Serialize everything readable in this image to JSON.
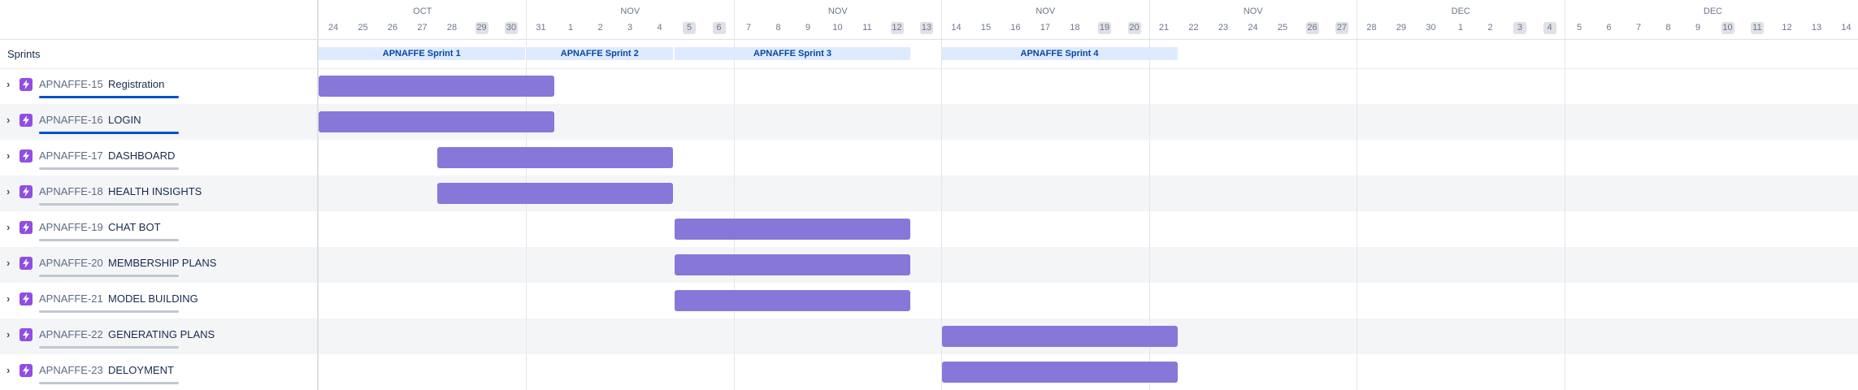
{
  "sprints_label": "Sprints",
  "colors": {
    "bar": "#8777d9",
    "sprint_bg": "#deebff",
    "sprint_text": "#0747a6",
    "progress_done": "#0052cc",
    "progress_todo": "#c1c7d0",
    "issue_icon": "#904ee2"
  },
  "months": [
    {
      "label": "OCT"
    },
    {
      "label": "NOV"
    },
    {
      "label": "NOV"
    },
    {
      "label": "NOV"
    },
    {
      "label": "NOV"
    },
    {
      "label": "DEC"
    },
    {
      "label": "DEC"
    }
  ],
  "days": [
    {
      "label": "24",
      "weekend": false
    },
    {
      "label": "25",
      "weekend": false
    },
    {
      "label": "26",
      "weekend": false
    },
    {
      "label": "27",
      "weekend": false
    },
    {
      "label": "28",
      "weekend": false
    },
    {
      "label": "29",
      "weekend": true
    },
    {
      "label": "30",
      "weekend": true
    },
    {
      "label": "31",
      "weekend": false
    },
    {
      "label": "1",
      "weekend": false
    },
    {
      "label": "2",
      "weekend": false
    },
    {
      "label": "3",
      "weekend": false
    },
    {
      "label": "4",
      "weekend": false
    },
    {
      "label": "5",
      "weekend": true
    },
    {
      "label": "6",
      "weekend": true
    },
    {
      "label": "7",
      "weekend": false
    },
    {
      "label": "8",
      "weekend": false
    },
    {
      "label": "9",
      "weekend": false
    },
    {
      "label": "10",
      "weekend": false
    },
    {
      "label": "11",
      "weekend": false
    },
    {
      "label": "12",
      "weekend": true
    },
    {
      "label": "13",
      "weekend": true
    },
    {
      "label": "14",
      "weekend": false
    },
    {
      "label": "15",
      "weekend": false
    },
    {
      "label": "16",
      "weekend": false
    },
    {
      "label": "17",
      "weekend": false
    },
    {
      "label": "18",
      "weekend": false
    },
    {
      "label": "19",
      "weekend": true
    },
    {
      "label": "20",
      "weekend": true
    },
    {
      "label": "21",
      "weekend": false
    },
    {
      "label": "22",
      "weekend": false
    },
    {
      "label": "23",
      "weekend": false
    },
    {
      "label": "24",
      "weekend": false
    },
    {
      "label": "25",
      "weekend": false
    },
    {
      "label": "26",
      "weekend": true
    },
    {
      "label": "27",
      "weekend": true
    },
    {
      "label": "28",
      "weekend": false
    },
    {
      "label": "29",
      "weekend": false
    },
    {
      "label": "30",
      "weekend": false
    },
    {
      "label": "1",
      "weekend": false
    },
    {
      "label": "2",
      "weekend": false
    },
    {
      "label": "3",
      "weekend": true
    },
    {
      "label": "4",
      "weekend": true
    },
    {
      "label": "5",
      "weekend": false
    },
    {
      "label": "6",
      "weekend": false
    },
    {
      "label": "7",
      "weekend": false
    },
    {
      "label": "8",
      "weekend": false
    },
    {
      "label": "9",
      "weekend": false
    },
    {
      "label": "10",
      "weekend": true
    },
    {
      "label": "11",
      "weekend": true
    },
    {
      "label": "12",
      "weekend": false
    },
    {
      "label": "13",
      "weekend": false
    },
    {
      "label": "14",
      "weekend": false
    }
  ],
  "sprints": [
    {
      "label": "APNAFFE Sprint 1"
    },
    {
      "label": "APNAFFE Sprint 2"
    },
    {
      "label": "APNAFFE Sprint 3"
    },
    {
      "label": "APNAFFE Sprint 4"
    }
  ],
  "issues": [
    {
      "key": "APNAFFE-15",
      "title": "Registration",
      "progress_done": 1.0
    },
    {
      "key": "APNAFFE-16",
      "title": "LOGIN",
      "progress_done": 1.0
    },
    {
      "key": "APNAFFE-17",
      "title": "DASHBOARD",
      "progress_done": 0.0
    },
    {
      "key": "APNAFFE-18",
      "title": "HEALTH INSIGHTS",
      "progress_done": 0.0
    },
    {
      "key": "APNAFFE-19",
      "title": "CHAT BOT",
      "progress_done": 0.0
    },
    {
      "key": "APNAFFE-20",
      "title": "MEMBERSHIP PLANS",
      "progress_done": 0.0
    },
    {
      "key": "APNAFFE-21",
      "title": "MODEL BUILDING",
      "progress_done": 0.0
    },
    {
      "key": "APNAFFE-22",
      "title": "GENERATING PLANS",
      "progress_done": 0.0
    },
    {
      "key": "APNAFFE-23",
      "title": "DELOYMENT",
      "progress_done": 0.0
    }
  ]
}
